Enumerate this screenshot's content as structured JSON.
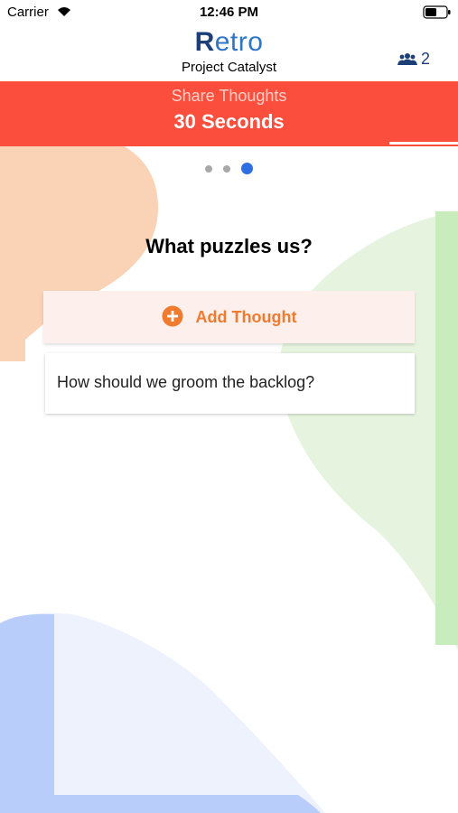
{
  "status_bar": {
    "carrier": "Carrier",
    "time": "12:46 PM"
  },
  "header": {
    "logo_initial": "R",
    "logo_rest": "etro",
    "project_name": "Project Catalyst",
    "participant_count": "2"
  },
  "phase": {
    "label": "Share Thoughts",
    "timer": "30 Seconds",
    "progress_remaining": 0.15
  },
  "pager": {
    "total_pages": 3,
    "current_page": 3
  },
  "prompt": {
    "title": "What puzzles us?",
    "add_button_label": "Add Thought"
  },
  "thoughts": [
    {
      "text": "How should we groom the backlog?"
    }
  ],
  "colors": {
    "accent_red": "#fb4e3c",
    "accent_orange": "#f07a2e",
    "brand_blue": "#2e75c7",
    "dot_active": "#2f6fe4"
  }
}
